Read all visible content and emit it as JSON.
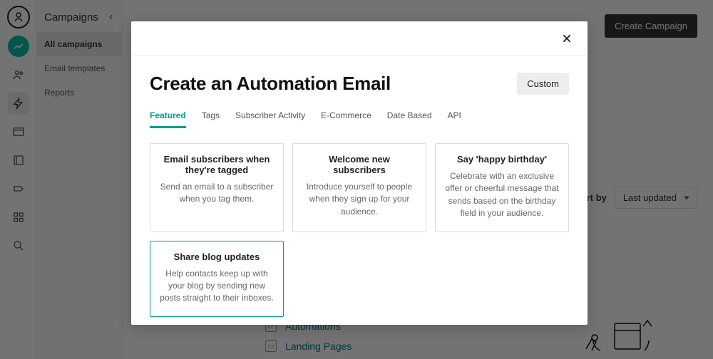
{
  "sidebar": {
    "title": "Campaigns",
    "items": [
      {
        "label": "All campaigns"
      },
      {
        "label": "Email templates"
      },
      {
        "label": "Reports"
      }
    ]
  },
  "topbar": {
    "create_campaign": "Create Campaign"
  },
  "sort": {
    "label": "Sort by",
    "value": "Last updated"
  },
  "subnav": {
    "automations": "Automations",
    "landing_pages": "Landing Pages"
  },
  "modal": {
    "title": "Create an Automation Email",
    "custom_btn": "Custom",
    "tabs": [
      {
        "label": "Featured"
      },
      {
        "label": "Tags"
      },
      {
        "label": "Subscriber Activity"
      },
      {
        "label": "E-Commerce"
      },
      {
        "label": "Date Based"
      },
      {
        "label": "API"
      }
    ],
    "cards": [
      {
        "title": "Email subscribers when they're tagged",
        "desc": "Send an email to a subscriber when you tag them."
      },
      {
        "title": "Welcome new subscribers",
        "desc": "Introduce yourself to people when they sign up for your audience."
      },
      {
        "title": "Say 'happy birthday'",
        "desc": "Celebrate with an exclusive offer or cheerful message that sends based on the birthday field in your audience."
      },
      {
        "title": "Share blog updates",
        "desc": "Help contacts keep up with your blog by sending new posts straight to their inboxes."
      }
    ]
  }
}
